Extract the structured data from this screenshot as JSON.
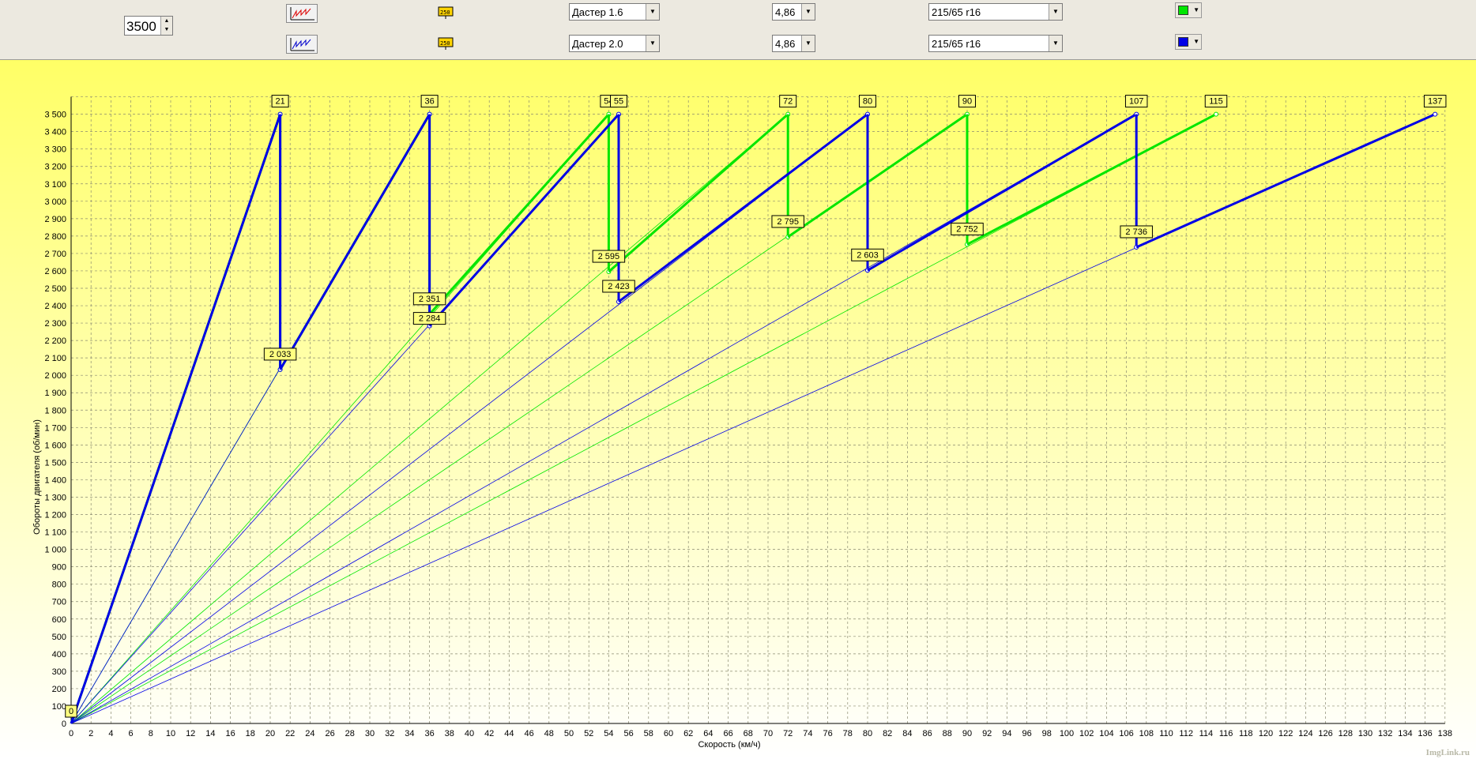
{
  "toolbar": {
    "rpm_value": "3500",
    "rows": [
      {
        "car": "Дастер 1.6",
        "ratio": "4,86",
        "tire": "215/65 r16",
        "color": "#00e600"
      },
      {
        "car": "Дастер 2.0",
        "ratio": "4,86",
        "tire": "215/65 r16",
        "color": "#0000e6"
      }
    ]
  },
  "chart_data": {
    "type": "line",
    "xlabel": "Скорость (км/ч)",
    "ylabel": "Обороты двигателя (об/мин)",
    "xlim": [
      0,
      138
    ],
    "ylim": [
      0,
      3600
    ],
    "x_tick_step": 2,
    "y_tick_step": 100,
    "grid": true,
    "background": [
      "#ffff66",
      "#ffffff"
    ],
    "max_rpm": 3500,
    "series": [
      {
        "color": "#00e600",
        "gears": [
          {
            "vmax": 21,
            "shift_rpm": 2033
          },
          {
            "vmax": 36,
            "shift_rpm": 2351
          },
          {
            "vmax": 54,
            "shift_rpm": 2595
          },
          {
            "vmax": 72,
            "shift_rpm": 2795
          },
          {
            "vmax": 90,
            "shift_rpm": 2752
          },
          {
            "vmax": 115,
            "shift_rpm": null
          }
        ]
      },
      {
        "color": "#0000e6",
        "gears": [
          {
            "vmax": 21,
            "shift_rpm": 2033
          },
          {
            "vmax": 36,
            "shift_rpm": 2284
          },
          {
            "vmax": 55,
            "shift_rpm": 2423
          },
          {
            "vmax": 80,
            "shift_rpm": 2603
          },
          {
            "vmax": 107,
            "shift_rpm": 2736
          },
          {
            "vmax": 137,
            "shift_rpm": null
          }
        ]
      }
    ],
    "top_labels": [
      "21",
      "36",
      "54",
      "55",
      "72",
      "80",
      "90",
      "107",
      "115",
      "137"
    ],
    "point_labels": [
      "0",
      "2 033",
      "2 351",
      "2 284",
      "2 595",
      "2 423",
      "2 795",
      "2 603",
      "2 752",
      "2 736"
    ]
  },
  "watermark": "ImgLink.ru"
}
